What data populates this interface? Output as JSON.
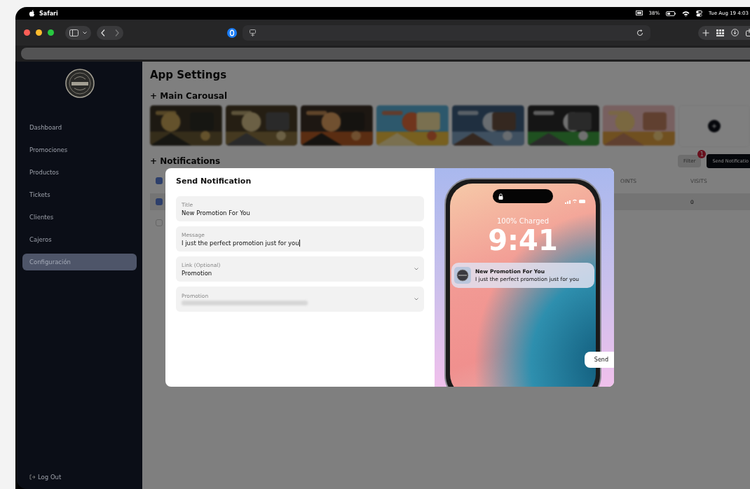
{
  "browser": {
    "app_name": "Safari",
    "battery_percent": "38%",
    "clock": "Tue Aug 19 4:03"
  },
  "sidebar": {
    "items": [
      {
        "label": "Dashboard",
        "selected": false
      },
      {
        "label": "Promociones",
        "selected": false
      },
      {
        "label": "Productos",
        "selected": false
      },
      {
        "label": "Tickets",
        "selected": false
      },
      {
        "label": "Clientes",
        "selected": false
      },
      {
        "label": "Cajeros",
        "selected": false
      },
      {
        "label": "Configuración",
        "selected": true
      }
    ],
    "logout": "Log Out"
  },
  "page": {
    "title": "App Settings",
    "carousel_heading": "+ Main Carousal",
    "notifications_heading": "+ Notifications",
    "filter_button": "Filter",
    "filter_badge": "1",
    "send_button": "Send Notificatio",
    "table": {
      "header_checked": true,
      "columns": [
        "OINTS",
        "VISITS"
      ],
      "rows": [
        {
          "checked": true,
          "column_2": "0"
        },
        {
          "checked": false
        }
      ]
    }
  },
  "dialog": {
    "title": "Send Notification",
    "fields": [
      {
        "kind": "text",
        "label": "Title",
        "value": "New Promotion For You",
        "focused": false
      },
      {
        "kind": "text",
        "label": "Message",
        "value": "I just the perfect promotion just for you",
        "focused": true
      },
      {
        "kind": "select",
        "label": "Link (Optional)",
        "value": "Promotion"
      },
      {
        "kind": "select",
        "label": "Promotion",
        "redacted": true
      }
    ],
    "preview": {
      "charge": "100% Charged",
      "time": "9:41",
      "notification_title": "New Promotion For You",
      "notification_body": "I just the perfect promotion just for you"
    },
    "send_button": "Send"
  }
}
